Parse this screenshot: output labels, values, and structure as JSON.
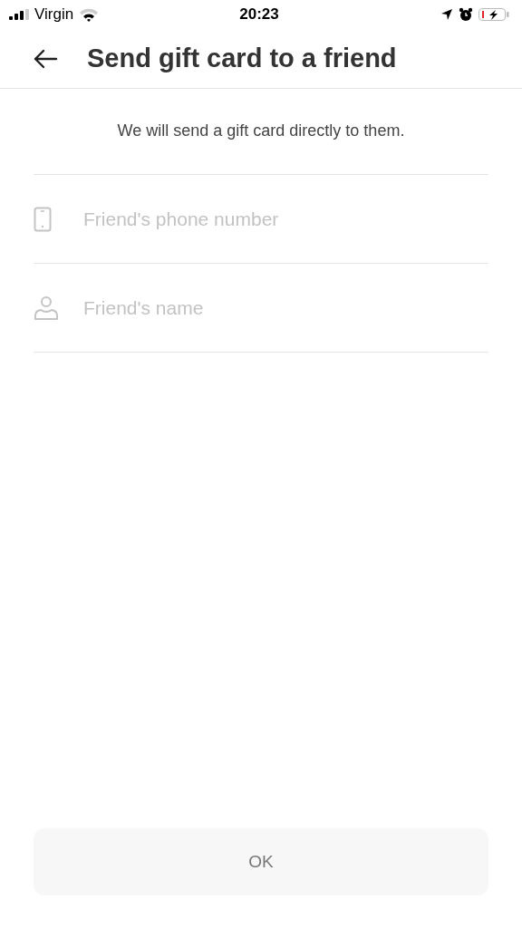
{
  "status_bar": {
    "carrier": "Virgin",
    "time": "20:23"
  },
  "header": {
    "title": "Send gift card to a friend"
  },
  "subtitle": "We will send a gift card directly to them.",
  "fields": [
    {
      "kind": "phone",
      "placeholder": "Friend's phone number"
    },
    {
      "kind": "person",
      "placeholder": "Friend's name"
    }
  ],
  "ok_button": {
    "label": "OK",
    "disabled": true
  }
}
